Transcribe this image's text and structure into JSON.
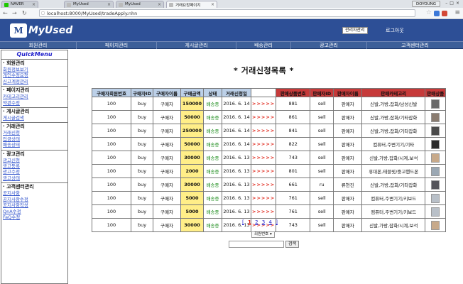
{
  "browser": {
    "tabs": [
      {
        "label": "NAVER"
      },
      {
        "label": "MyUsed"
      },
      {
        "label": "MyUsed"
      },
      {
        "label": "거래요청페이지"
      }
    ],
    "user": "DOYOUNG",
    "url": "localhost:8000/MyUsed/tradeApply.nhn"
  },
  "header": {
    "logo_mark": "M",
    "logo_text": "MyUsed",
    "admin_button": "관리자관리",
    "logout": "로그아웃"
  },
  "menu": [
    "회원관리",
    "페이지관리",
    "게시글관리",
    "배송관리",
    "광고관리",
    "고객센터관리"
  ],
  "sidebar": {
    "title": "QuickMenu",
    "groups": [
      {
        "title": "· 회원관리",
        "links": [
          "회원정보보기",
          "개인수정요청",
          "신고계정관리"
        ]
      },
      {
        "title": "· 페이지관리",
        "links": [
          "카테고리관리",
          "약관수정"
        ]
      },
      {
        "title": "· 게시글관리",
        "links": [
          "게시글검색"
        ]
      },
      {
        "title": "· 거래관리",
        "links": [
          "거래신청",
          "입금상태",
          "배송상태"
        ]
      },
      {
        "title": "· 광고관리",
        "links": [
          "광고신청",
          "광고등록",
          "광고수정",
          "광고상태"
        ]
      },
      {
        "title": "· 고객센터관리",
        "links": [
          "공지사항",
          "공지사항수정",
          "공지사항작성",
          "QnA수정",
          "FaQ수정"
        ]
      }
    ]
  },
  "page_title": "* 거래신청목록 *",
  "table": {
    "headers": [
      "구매자회원번호",
      "구매자ID",
      "구매자이름",
      "구매금액",
      "상태",
      "거래신청일",
      "",
      "판매상품번호",
      "판매자ID",
      "판매자이름",
      "판매카테고리",
      "판매상품"
    ],
    "rows": [
      {
        "cells": [
          "100",
          "buy",
          "구매자",
          "150000",
          "배송중",
          "2016. 6. 14",
          ">>>>>",
          "881",
          "sell",
          "판매자",
          "신발,가방,잡화/남성신발"
        ],
        "thumb": "#6a6a6a"
      },
      {
        "cells": [
          "100",
          "buy",
          "구매자",
          "50000",
          "배송중",
          "2016. 6. 14",
          ">>>>>",
          "861",
          "sell",
          "판매자",
          "신발,가방,잡화/기타잡화"
        ],
        "thumb": "#8a7c70"
      },
      {
        "cells": [
          "100",
          "buy",
          "구매자",
          "250000",
          "배송중",
          "2016. 6. 14",
          ">>>>>",
          "841",
          "sell",
          "판매자",
          "신발,가방,잡화/기타잡화"
        ],
        "thumb": "#4b4b4b"
      },
      {
        "cells": [
          "100",
          "buy",
          "구매자",
          "50000",
          "배송중",
          "2016. 6. 14",
          ">>>>>",
          "822",
          "sell",
          "판매자",
          "컴퓨터,주변기기/기타"
        ],
        "thumb": "#2a2a2a"
      },
      {
        "cells": [
          "100",
          "buy",
          "구매자",
          "30000",
          "배송중",
          "2016. 6. 13",
          ">>>>>",
          "743",
          "sell",
          "판매자",
          "신발,가방,잡화/시계,보석"
        ],
        "thumb": "#c7a98a"
      },
      {
        "cells": [
          "100",
          "buy",
          "구매자",
          "2000",
          "배송중",
          "2016. 6. 13",
          ">>>>>",
          "801",
          "sell",
          "판매자",
          "휴대폰,태블릿/중고핸드폰"
        ],
        "thumb": "#9aa7b3"
      },
      {
        "cells": [
          "100",
          "buy",
          "구매자",
          "30000",
          "배송중",
          "2016. 6. 13",
          ">>>>>",
          "661",
          "ru",
          "류현진",
          "신발,가방,잡화/기타잡화"
        ],
        "thumb": "#55555a"
      },
      {
        "cells": [
          "100",
          "buy",
          "구매자",
          "5000",
          "배송중",
          "2016. 6. 13",
          ">>>>>",
          "761",
          "sell",
          "판매자",
          "컴퓨터,주변기기/키보드"
        ],
        "thumb": "#b9c0c8"
      },
      {
        "cells": [
          "100",
          "buy",
          "구매자",
          "5000",
          "배송중",
          "2016. 6. 13",
          ">>>>>",
          "761",
          "sell",
          "판매자",
          "컴퓨터,주변기기/키보드"
        ],
        "thumb": "#b9c0c8"
      },
      {
        "cells": [
          "100",
          "buy",
          "구매자",
          "30000",
          "배송중",
          "2016. 6. 13",
          ">>>>>",
          "743",
          "sell",
          "판매자",
          "신발,가방,잡화/시계,보석"
        ],
        "thumb": "#c7a98a"
      }
    ]
  },
  "pagination": {
    "pages": [
      "1",
      "2",
      "3",
      "4"
    ],
    "current": "1"
  },
  "search": {
    "select_value": "회원번호",
    "button": "검색"
  },
  "colors": {
    "header_bg": "#2d4f96",
    "amount_bg": "#ffee88",
    "seller_header_bg": "#c63a3a",
    "buyer_header_bg": "#bcd0e8"
  }
}
